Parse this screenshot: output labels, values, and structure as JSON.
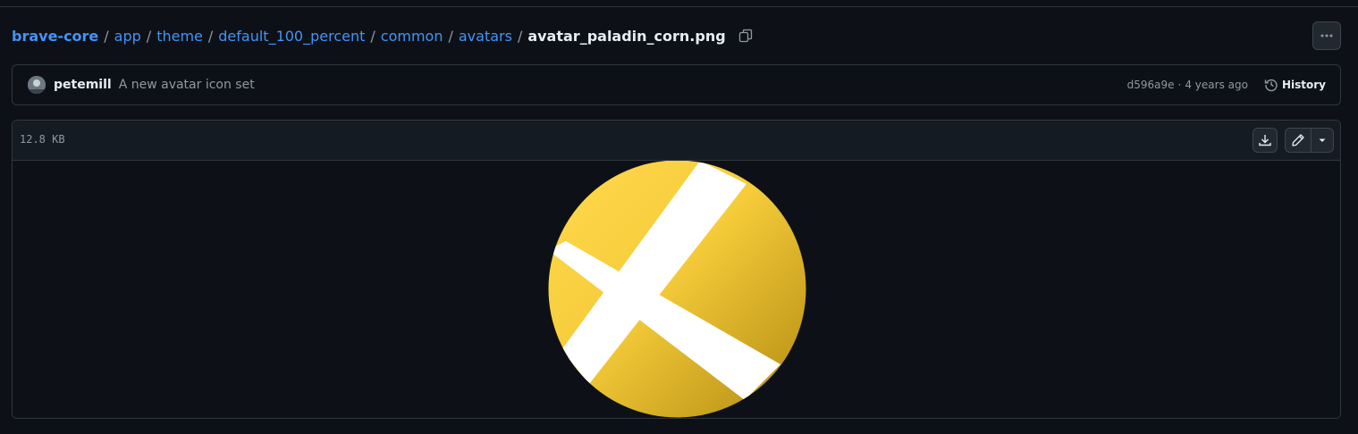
{
  "breadcrumb": {
    "repo": "brave-core",
    "segments": [
      "app",
      "theme",
      "default_100_percent",
      "common",
      "avatars"
    ],
    "separator": "/",
    "current_file": "avatar_paladin_corn.png"
  },
  "commit": {
    "author": "petemill",
    "message": "A new avatar icon set",
    "sha": "d596a9e",
    "separator": "·",
    "time_ago": "4 years ago",
    "history_label": "History"
  },
  "file": {
    "size": "12.8 KB"
  },
  "icons": {
    "copy": "copy-icon",
    "more": "kebab-horizontal-icon",
    "history": "history-icon",
    "download": "download-icon",
    "edit": "pencil-icon",
    "caret": "triangle-down-icon"
  },
  "colors": {
    "background": "#0d1117",
    "link": "#4493f8",
    "border": "#30363d",
    "muted": "#9198a1",
    "avatar_gold_light": "#ffd84d",
    "avatar_gold_dark": "#b8900f",
    "avatar_band": "#ffffff"
  }
}
